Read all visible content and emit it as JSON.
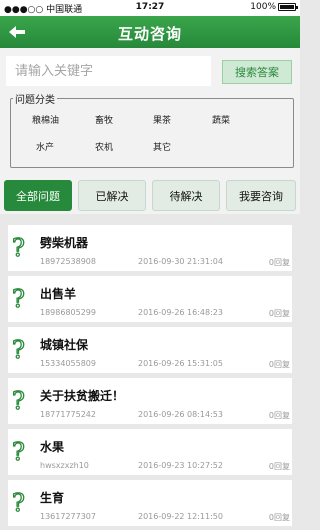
{
  "status_bar": {
    "carrier": "●●●○○ 中国联通",
    "time": "17:27",
    "battery": "100%"
  },
  "header": {
    "title": "互动咨询"
  },
  "search": {
    "placeholder": "请输入关键字",
    "button_label": "搜索答案"
  },
  "categories": {
    "title": "问题分类",
    "items": [
      "粮棉油",
      "畜牧",
      "果茶",
      "蔬菜",
      "水产",
      "农机",
      "其它"
    ]
  },
  "tabs": [
    {
      "label": "全部问题",
      "active": true
    },
    {
      "label": "已解决",
      "active": false
    },
    {
      "label": "待解决",
      "active": false
    },
    {
      "label": "我要咨询",
      "active": false
    }
  ],
  "questions": [
    {
      "title": "劈柴机器",
      "user": "18972538908",
      "date": "2016-09-30 21:31:04",
      "replies": "0回复"
    },
    {
      "title": "出售羊",
      "user": "18986805299",
      "date": "2016-09-26 16:48:23",
      "replies": "0回复"
    },
    {
      "title": "城镇社保",
      "user": "15334055809",
      "date": "2016-09-26 15:31:05",
      "replies": "0回复"
    },
    {
      "title": "关于扶贫搬迁！",
      "user": "18771775242",
      "date": "2016-09-26 08:14:53",
      "replies": "0回复"
    },
    {
      "title": "水果",
      "user": "hwsxzxzh10",
      "date": "2016-09-23 10:27:52",
      "replies": "0回复"
    },
    {
      "title": "生育",
      "user": "13617277307",
      "date": "2016-09-22 12:11:50",
      "replies": "0回复"
    }
  ],
  "colors": {
    "primary_green": "#27893b",
    "question_icon": "#2a8a3c"
  }
}
